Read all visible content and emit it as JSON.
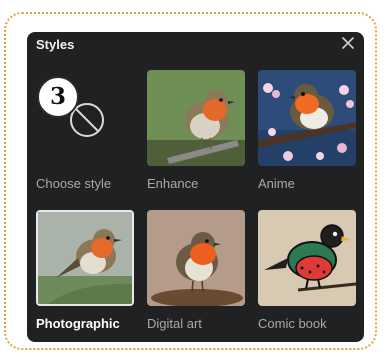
{
  "dialog": {
    "title": "Styles",
    "close_icon": "close-icon",
    "step_number": "3"
  },
  "styles": [
    {
      "label": "Choose style",
      "selected": false,
      "icon": "no-style-icon"
    },
    {
      "label": "Enhance",
      "selected": false
    },
    {
      "label": "Anime",
      "selected": false
    },
    {
      "label": "Photographic",
      "selected": true
    },
    {
      "label": "Digital art",
      "selected": false
    },
    {
      "label": "Comic book",
      "selected": false
    }
  ],
  "colors": {
    "panel_bg": "#202122",
    "frame_border": "#e9a040",
    "label_default": "#a9a9a9",
    "label_selected": "#ffffff"
  }
}
